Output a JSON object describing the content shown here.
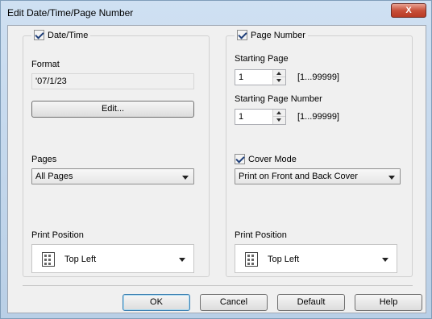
{
  "window": {
    "title": "Edit Date/Time/Page Number",
    "close_label": "X"
  },
  "date_time": {
    "legend": "Date/Time",
    "checked": true,
    "format_label": "Format",
    "format_value": "'07/1/23",
    "edit_label": "Edit...",
    "pages_label": "Pages",
    "pages_value": "All Pages",
    "print_position_label": "Print Position",
    "print_position_value": "Top Left"
  },
  "page_number": {
    "legend": "Page Number",
    "checked": true,
    "starting_page_label": "Starting Page",
    "starting_page_value": "1",
    "starting_page_range": "[1...99999]",
    "starting_page_number_label": "Starting Page Number",
    "starting_page_number_value": "1",
    "starting_page_number_range": "[1...99999]",
    "cover_mode_label": "Cover Mode",
    "cover_mode_checked": true,
    "cover_mode_value": "Print on Front and Back Cover",
    "print_position_label": "Print Position",
    "print_position_value": "Top Left"
  },
  "footer": {
    "ok": "OK",
    "cancel": "Cancel",
    "default": "Default",
    "help": "Help"
  }
}
